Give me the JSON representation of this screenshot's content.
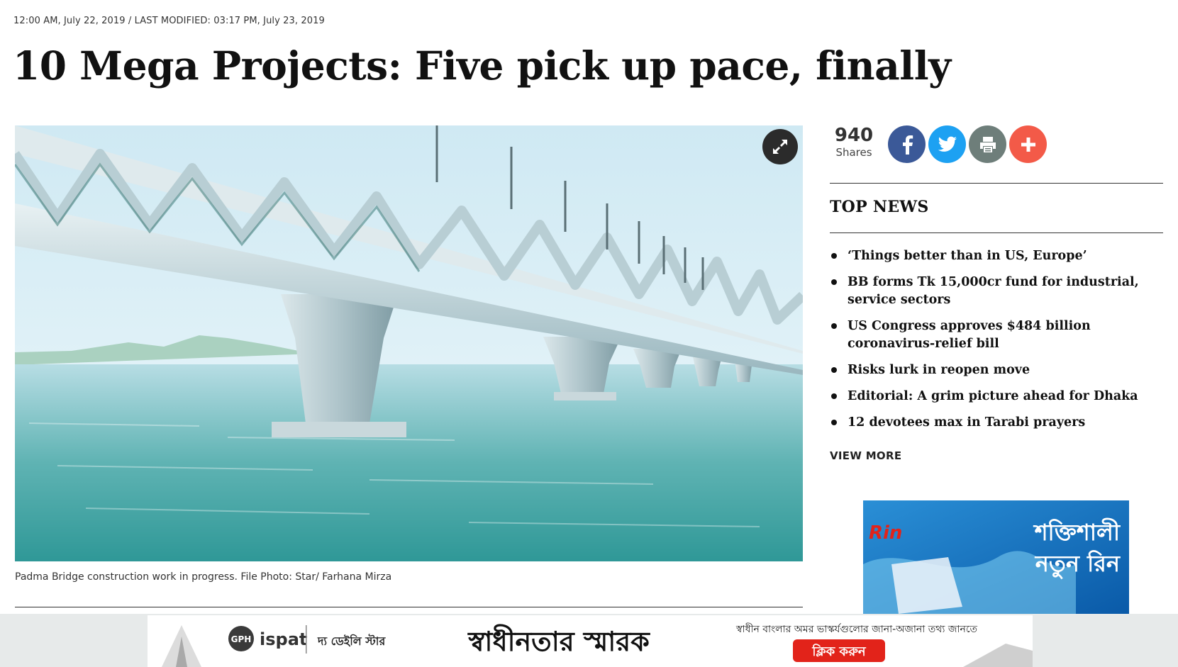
{
  "article": {
    "dateline": "12:00 AM, July 22, 2019 / LAST MODIFIED: 03:17 PM, July 23, 2019",
    "headline": "10 Mega Projects: Five pick up pace, finally",
    "photo_caption": "Padma Bridge construction work in progress. File Photo: Star/ Farhana Mirza"
  },
  "share": {
    "count": "940",
    "count_label": "Shares",
    "buttons": [
      "facebook-icon",
      "twitter-icon",
      "print-icon",
      "plus-icon"
    ],
    "colors": {
      "facebook": "#3b5998",
      "twitter": "#1da1f2",
      "print": "#6e7e7a",
      "plus": "#f35a48"
    }
  },
  "top_news": {
    "title": "TOP NEWS",
    "items": [
      {
        "label": "‘Things better than in US, Europe’"
      },
      {
        "label": "BB forms Tk 15,000cr fund for industrial, service sectors"
      },
      {
        "label": "US Congress approves $484 billion coronavirus-relief bill"
      },
      {
        "label": "Risks lurk in reopen move"
      },
      {
        "label": "Editorial: A grim picture ahead for Dhaka"
      },
      {
        "label": "12 devotees max in Tarabi prayers"
      }
    ],
    "view_more": "VIEW MORE"
  },
  "ads": {
    "side": {
      "brand": "Rin",
      "line1": "শক্তিশালী",
      "line2": "নতুন রিন"
    },
    "bottom": {
      "sponsor1": "GPH",
      "sponsor2": "ispat",
      "sponsor3": "দ্য ডেইলি স্টার",
      "title": "স্বাধীনতার স্মারক",
      "tagline": "স্বাধীন বাংলার অমর ভাস্কর্যগুলোর জানা-অজানা তথ্য জানতে",
      "cta": "ক্লিক করুন"
    }
  }
}
